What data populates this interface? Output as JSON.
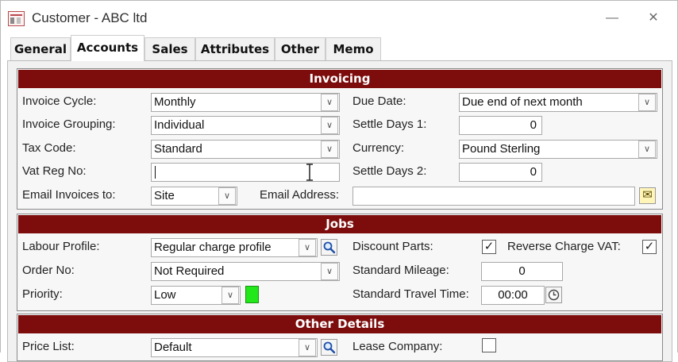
{
  "window": {
    "title": "Customer - ABC ltd",
    "minimize_glyph": "—",
    "close_glyph": "✕"
  },
  "tabs": [
    "General",
    "Accounts",
    "Sales",
    "Attributes",
    "Other",
    "Memo"
  ],
  "active_tab": "Accounts",
  "sections": {
    "invoicing": "Invoicing",
    "jobs": "Jobs",
    "other": "Other Details"
  },
  "invoicing": {
    "invoice_cycle": {
      "label": "Invoice Cycle:",
      "value": "Monthly"
    },
    "invoice_grouping": {
      "label": "Invoice Grouping:",
      "value": "Individual"
    },
    "tax_code": {
      "label": "Tax Code:",
      "value": "Standard"
    },
    "vat_reg_no": {
      "label": "Vat Reg No:",
      "value": ""
    },
    "email_invoices_to": {
      "label": "Email Invoices to:",
      "value": "Site"
    },
    "due_date": {
      "label": "Due Date:",
      "value": "Due end of next month"
    },
    "settle_days_1": {
      "label": "Settle Days 1:",
      "value": "0"
    },
    "currency": {
      "label": "Currency:",
      "value": "Pound Sterling"
    },
    "settle_days_2": {
      "label": "Settle Days 2:",
      "value": "0"
    },
    "email_address": {
      "label": "Email Address:",
      "value": ""
    }
  },
  "jobs": {
    "labour_profile": {
      "label": "Labour Profile:",
      "value": "Regular charge profile"
    },
    "order_no": {
      "label": "Order No:",
      "value": "Not Required"
    },
    "priority": {
      "label": "Priority:",
      "value": "Low",
      "color": "#22e71a"
    },
    "discount_parts": {
      "label": "Discount Parts:",
      "checked": true
    },
    "reverse_charge_vat": {
      "label": "Reverse Charge VAT:",
      "checked": true
    },
    "standard_mileage": {
      "label": "Standard Mileage:",
      "value": "0"
    },
    "standard_travel_time": {
      "label": "Standard Travel Time:",
      "value": "00:00"
    }
  },
  "other_details": {
    "price_list": {
      "label": "Price List:",
      "value": "Default"
    },
    "lease_company": {
      "label": "Lease Company:",
      "checked": false
    }
  },
  "glyphs": {
    "dropdown": "∨",
    "check": "✓",
    "envelope": "✉"
  },
  "colors": {
    "section_header": "#7d0c0c",
    "priority_swatch": "#22e71a"
  }
}
